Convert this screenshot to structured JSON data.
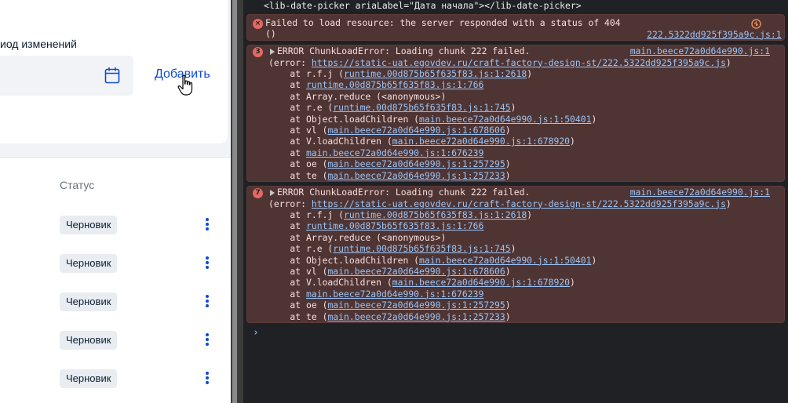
{
  "app": {
    "period_label": "иод изменений",
    "add_label": "Добавить",
    "status_header": "Статус",
    "rows": [
      "Черновик",
      "Черновик",
      "Черновик",
      "Черновик",
      "Черновик"
    ]
  },
  "console": {
    "html_line": "<lib-date-picker ariaLabel=\"Дата начала\"></lib-date-picker>",
    "resource_error": {
      "text": "Failed to load resource: the server responded with a status of 404",
      "paren": "()",
      "source": "222.5322dd925f395a9c.js:1"
    },
    "chunk_errors": [
      {
        "count": "3",
        "title": "ERROR ChunkLoadError: Loading chunk 222 failed.",
        "source": "main.beece72a0d64e990.js:1",
        "error_prefix": "(error: ",
        "error_url": "https://static-uat.egovdev.ru/craft-factory-design-st/222.5322dd925f395a9c.js",
        "error_suffix": ")",
        "stack": [
          {
            "pre": "    at r.f.j (",
            "link": "runtime.00d875b65f635f83.js:1:2618",
            "post": ")"
          },
          {
            "pre": "    at ",
            "link": "runtime.00d875b65f635f83.js:1:766",
            "post": ""
          },
          {
            "pre": "    at Array.reduce (<anonymous>)",
            "link": "",
            "post": ""
          },
          {
            "pre": "    at r.e (",
            "link": "runtime.00d875b65f635f83.js:1:745",
            "post": ")"
          },
          {
            "pre": "    at Object.loadChildren (",
            "link": "main.beece72a0d64e990.js:1:50401",
            "post": ")"
          },
          {
            "pre": "    at vl (",
            "link": "main.beece72a0d64e990.js:1:678606",
            "post": ")"
          },
          {
            "pre": "    at V.loadChildren (",
            "link": "main.beece72a0d64e990.js:1:678920",
            "post": ")"
          },
          {
            "pre": "    at ",
            "link": "main.beece72a0d64e990.js:1:676239",
            "post": ""
          },
          {
            "pre": "    at oe (",
            "link": "main.beece72a0d64e990.js:1:257295",
            "post": ")"
          },
          {
            "pre": "    at te (",
            "link": "main.beece72a0d64e990.js:1:257233",
            "post": ")"
          }
        ]
      },
      {
        "count": "7",
        "title": "ERROR ChunkLoadError: Loading chunk 222 failed.",
        "source": "main.beece72a0d64e990.js:1",
        "error_prefix": "(error: ",
        "error_url": "https://static-uat.egovdev.ru/craft-factory-design-st/222.5322dd925f395a9c.js",
        "error_suffix": ")",
        "stack": [
          {
            "pre": "    at r.f.j (",
            "link": "runtime.00d875b65f635f83.js:1:2618",
            "post": ")"
          },
          {
            "pre": "    at ",
            "link": "runtime.00d875b65f635f83.js:1:766",
            "post": ""
          },
          {
            "pre": "    at Array.reduce (<anonymous>)",
            "link": "",
            "post": ""
          },
          {
            "pre": "    at r.e (",
            "link": "runtime.00d875b65f635f83.js:1:745",
            "post": ")"
          },
          {
            "pre": "    at Object.loadChildren (",
            "link": "main.beece72a0d64e990.js:1:50401",
            "post": ")"
          },
          {
            "pre": "    at vl (",
            "link": "main.beece72a0d64e990.js:1:678606",
            "post": ")"
          },
          {
            "pre": "    at V.loadChildren (",
            "link": "main.beece72a0d64e990.js:1:678920",
            "post": ")"
          },
          {
            "pre": "    at ",
            "link": "main.beece72a0d64e990.js:1:676239",
            "post": ""
          },
          {
            "pre": "    at oe (",
            "link": "main.beece72a0d64e990.js:1:257295",
            "post": ")"
          },
          {
            "pre": "    at te (",
            "link": "main.beece72a0d64e990.js:1:257233",
            "post": ")"
          }
        ]
      }
    ],
    "prompt": "›"
  },
  "colors": {
    "accent": "#0d4cd3",
    "console_bg": "#202124",
    "error_bg": "#4e3534",
    "link": "#9cc3f5",
    "error_icon": "#e46962"
  }
}
